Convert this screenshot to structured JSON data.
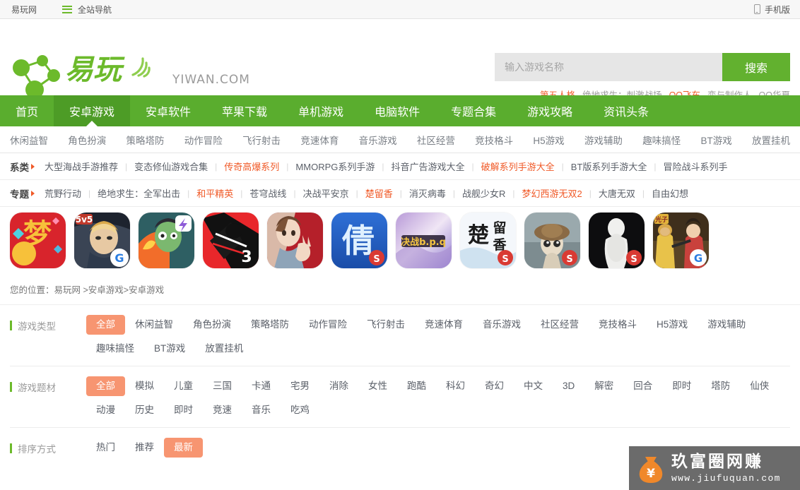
{
  "topbar": {
    "site_name": "易玩网",
    "nav_icon": "list-icon",
    "nav_label": "全站导航",
    "mobile_icon": "phone-icon",
    "mobile_label": "手机版"
  },
  "header": {
    "logo_cn": "易玩",
    "logo_en": "YIWAN.COM",
    "logo_icon": "network-nodes-icon",
    "brand_green": "#6cba2b"
  },
  "search": {
    "placeholder": "输入游戏名称",
    "value": "",
    "button_label": "搜索",
    "button_color": "#62b12f",
    "hotwords": [
      {
        "label": "第五人格",
        "highlight": true
      },
      {
        "label": "绝地求生：刺激战场",
        "highlight": false
      },
      {
        "label": "QQ飞车",
        "highlight": true
      },
      {
        "label": "恋与制作人",
        "highlight": false
      },
      {
        "label": "QQ华夏",
        "highlight": false
      }
    ]
  },
  "mainnav": {
    "bg_color": "#5aad2e",
    "active_color": "#4d9c26",
    "items": [
      {
        "label": "首页",
        "active": false
      },
      {
        "label": "安卓游戏",
        "active": true
      },
      {
        "label": "安卓软件",
        "active": false
      },
      {
        "label": "苹果下载",
        "active": false
      },
      {
        "label": "单机游戏",
        "active": false
      },
      {
        "label": "电脑软件",
        "active": false
      },
      {
        "label": "专题合集",
        "active": false
      },
      {
        "label": "游戏攻略",
        "active": false
      },
      {
        "label": "资讯头条",
        "active": false
      }
    ]
  },
  "subnav": {
    "items": [
      "休闲益智",
      "角色扮演",
      "策略塔防",
      "动作冒险",
      "飞行射击",
      "竞速体育",
      "音乐游戏",
      "社区经营",
      "竞技格斗",
      "H5游戏",
      "游戏辅助",
      "趣味搞怪",
      "BT游戏",
      "放置挂机"
    ]
  },
  "series_row": {
    "label": "系类",
    "items": [
      {
        "label": "大型海战手游推荐",
        "highlight": false
      },
      {
        "label": "变态修仙游戏合集",
        "highlight": false
      },
      {
        "label": "传奇高爆系列",
        "highlight": true
      },
      {
        "label": "MMORPG系列手游",
        "highlight": false
      },
      {
        "label": "抖音广告游戏大全",
        "highlight": false
      },
      {
        "label": "破解系列手游大全",
        "highlight": true
      },
      {
        "label": "BT版系列手游大全",
        "highlight": false
      },
      {
        "label": "冒险战斗系列手",
        "highlight": false
      }
    ]
  },
  "topic_row": {
    "label": "专题",
    "items": [
      {
        "label": "荒野行动",
        "highlight": false
      },
      {
        "label": "绝地求生：全军出击",
        "highlight": false
      },
      {
        "label": "和平精英",
        "highlight": true
      },
      {
        "label": "苍穹战线",
        "highlight": false
      },
      {
        "label": "决战平安京",
        "highlight": false
      },
      {
        "label": "楚留香",
        "highlight": true
      },
      {
        "label": "消灭病毒",
        "highlight": false
      },
      {
        "label": "战舰少女R",
        "highlight": false
      },
      {
        "label": "梦幻西游无双2",
        "highlight": true
      },
      {
        "label": "大唐无双",
        "highlight": false
      },
      {
        "label": "自由幻想",
        "highlight": false
      }
    ]
  },
  "game_icons": [
    {
      "name": "meng-rpg-icon",
      "alt": "梦"
    },
    {
      "name": "wangzhe-rongyao-icon",
      "alt": "5v5"
    },
    {
      "name": "fire-boy-icon",
      "alt": ""
    },
    {
      "name": "ninja-3-icon",
      "alt": "3"
    },
    {
      "name": "anime-boy-icon",
      "alt": ""
    },
    {
      "name": "qiannv-youhun-icon",
      "alt": "倩"
    },
    {
      "name": "juezhan-icon",
      "alt": ""
    },
    {
      "name": "chuliuxiang-icon",
      "alt": "楚留香"
    },
    {
      "name": "diwuregge-girl-icon",
      "alt": ""
    },
    {
      "name": "ghost-figure-icon",
      "alt": ""
    },
    {
      "name": "pubg-mobile-icon",
      "alt": "光子"
    }
  ],
  "breadcrumb": {
    "prefix": "您的位置：",
    "items": [
      "易玩网",
      ">安卓游戏",
      ">安卓游戏"
    ],
    "full": "您的位置：易玩网 >安卓游戏>安卓游戏"
  },
  "filters": [
    {
      "label": "游戏类型",
      "options": [
        {
          "label": "全部",
          "active": true
        },
        {
          "label": "休闲益智",
          "active": false
        },
        {
          "label": "角色扮演",
          "active": false
        },
        {
          "label": "策略塔防",
          "active": false
        },
        {
          "label": "动作冒险",
          "active": false
        },
        {
          "label": "飞行射击",
          "active": false
        },
        {
          "label": "竞速体育",
          "active": false
        },
        {
          "label": "音乐游戏",
          "active": false
        },
        {
          "label": "社区经营",
          "active": false
        },
        {
          "label": "竞技格斗",
          "active": false
        },
        {
          "label": "H5游戏",
          "active": false
        },
        {
          "label": "游戏辅助",
          "active": false
        },
        {
          "label": "趣味搞怪",
          "active": false
        },
        {
          "label": "BT游戏",
          "active": false
        },
        {
          "label": "放置挂机",
          "active": false
        }
      ]
    },
    {
      "label": "游戏题材",
      "options": [
        {
          "label": "全部",
          "active": true
        },
        {
          "label": "模拟",
          "active": false
        },
        {
          "label": "儿童",
          "active": false
        },
        {
          "label": "三国",
          "active": false
        },
        {
          "label": "卡通",
          "active": false
        },
        {
          "label": "宅男",
          "active": false
        },
        {
          "label": "消除",
          "active": false
        },
        {
          "label": "女性",
          "active": false
        },
        {
          "label": "跑酷",
          "active": false
        },
        {
          "label": "科幻",
          "active": false
        },
        {
          "label": "奇幻",
          "active": false
        },
        {
          "label": "中文",
          "active": false
        },
        {
          "label": "3D",
          "active": false
        },
        {
          "label": "解密",
          "active": false
        },
        {
          "label": "回合",
          "active": false
        },
        {
          "label": "即时",
          "active": false
        },
        {
          "label": "塔防",
          "active": false
        },
        {
          "label": "仙侠",
          "active": false
        },
        {
          "label": "动漫",
          "active": false
        },
        {
          "label": "历史",
          "active": false
        },
        {
          "label": "即时",
          "active": false
        },
        {
          "label": "竞速",
          "active": false
        },
        {
          "label": "音乐",
          "active": false
        },
        {
          "label": "吃鸡",
          "active": false
        }
      ]
    },
    {
      "label": "排序方式",
      "options": [
        {
          "label": "热门",
          "active": false
        },
        {
          "label": "推荐",
          "active": false
        },
        {
          "label": "最新",
          "active": true
        }
      ]
    }
  ],
  "active_option_color": "#f79571",
  "watermark": {
    "cn_text": "玖富圈网赚",
    "url_text": "www.jiufuquan.com",
    "icon": "money-bag-icon",
    "bg_color": "#6b6b6b"
  }
}
